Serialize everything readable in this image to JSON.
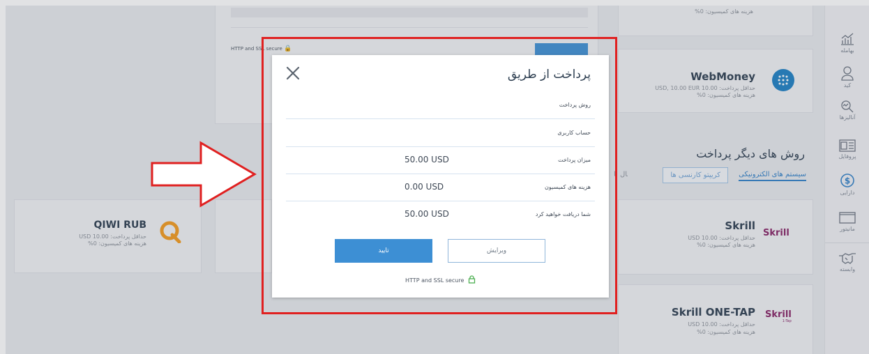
{
  "sidebar": {
    "items": [
      {
        "label": "بهامله",
        "icon": "chart-icon"
      },
      {
        "label": "کید",
        "icon": "user-icon"
      },
      {
        "label": "آنالیزها",
        "icon": "analytics-icon"
      },
      {
        "label": "پروفایل",
        "icon": "profile-card-icon"
      },
      {
        "label": "دارایی",
        "icon": "dollar-icon"
      },
      {
        "label": "مانیتور",
        "icon": "monitor-icon"
      },
      {
        "label": "وابسته",
        "icon": "handshake-icon"
      }
    ]
  },
  "top_card": {
    "secure_text": "HTTP and SSL secure",
    "commission": "هزینه های کمیسیون: 0%"
  },
  "webmoney": {
    "name": "WebMoney",
    "min": "حداقل پرداخت: 10.00 USD, 10.00 EUR",
    "commission": "هزینه های کمیسیون: 0%"
  },
  "other_methods": {
    "title": "روش های دیگر پرداخت",
    "tabs": [
      "سیستم های الکترونیکی",
      "کریپتو کارنسی ها",
      "انتقال با"
    ]
  },
  "skrill": {
    "name": "Skrill",
    "min": "حداقل پرداخت: 10.00 USD",
    "commission": "هزینه های کمیسیون: 0%",
    "logo": "Skrill"
  },
  "skrill_onetap": {
    "name": "Skrill ONE-TAP",
    "min": "حداقل پرداخت: 10.00 USD",
    "commission": "هزینه های کمیسیون: 0%",
    "logo": "Skrill",
    "logo_sub": "1-Tap"
  },
  "qiwi": {
    "name": "QIWI RUB",
    "min": "حداقل پرداخت: 10.00 USD",
    "commission": "هزینه های کمیسیون: 0%"
  },
  "modal": {
    "title": "پرداخت از طریق",
    "rows": [
      {
        "label": "روش پرداخت",
        "value": ""
      },
      {
        "label": "حساب کاربری",
        "value": ""
      },
      {
        "label": "میزان پرداخت",
        "value": "50.00 USD"
      },
      {
        "label": "هزینه های کمیسیون",
        "value": "0.00 USD"
      },
      {
        "label": "شما دریافت خواهید کرد",
        "value": "50.00 USD"
      }
    ],
    "edit_label": "ویرایش",
    "confirm_label": "تایید",
    "secure_text": "HTTP and SSL secure"
  },
  "colors": {
    "accent": "#3d8fd4",
    "highlight": "#e02020",
    "skrill": "#862165",
    "qiwi": "#f39a1d"
  }
}
